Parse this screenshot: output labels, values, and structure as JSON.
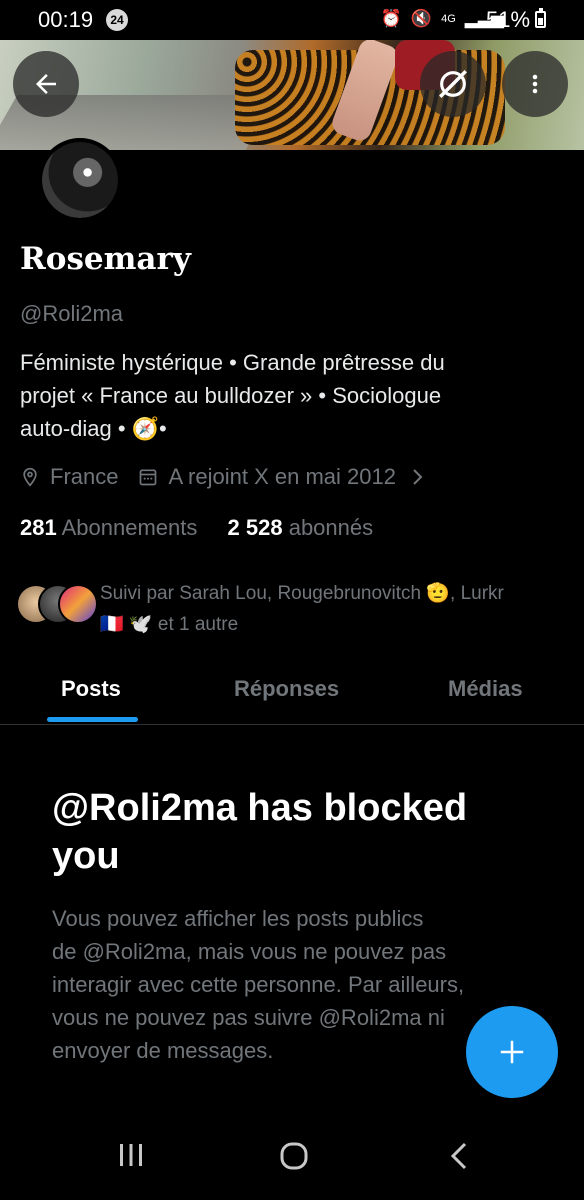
{
  "status_bar": {
    "time": "00:19",
    "notification_count": "24",
    "network": "4G",
    "battery": "51%",
    "battery_level": 0.51
  },
  "header": {
    "back_icon": "arrow-left-icon",
    "grok_icon": "grok-icon",
    "more_icon": "more-vertical-icon"
  },
  "profile": {
    "name": "Rosemary",
    "handle": "@Roli2ma",
    "bio_lines": [
      "Féministe hystérique • Grande prêtresse du",
      "projet « France au bulldozer » • Sociologue",
      "auto-diag • 🧭•"
    ],
    "location": "France",
    "joined": "A rejoint X en mai 2012",
    "following_count": "281",
    "following_label": "Abonnements",
    "followers_count": "2 528",
    "followers_label": "abonnés",
    "followed_by_line1": "Suivi par Sarah Lou, Rougebrunovitch 🫡, Lurkr",
    "followed_by_line2": "🇫🇷 🕊️ et 1 autre"
  },
  "tabs": [
    "Posts",
    "Réponses",
    "Médias"
  ],
  "active_tab": "Posts",
  "blocked": {
    "title_line1": "@Roli2ma has blocked",
    "title_line2": "you",
    "body_lines": [
      "Vous pouvez afficher les posts publics",
      "de @Roli2ma, mais vous ne pouvez pas",
      "interagir avec cette personne. Par ailleurs,",
      "vous ne pouvez pas suivre @Roli2ma ni",
      "envoyer de messages."
    ]
  },
  "fab_icon": "plus-icon",
  "nav": [
    "recent-apps-icon",
    "home-icon",
    "back-icon"
  ],
  "colors": {
    "accent": "#1d9bf0",
    "muted": "#71767b",
    "background": "#000000"
  }
}
